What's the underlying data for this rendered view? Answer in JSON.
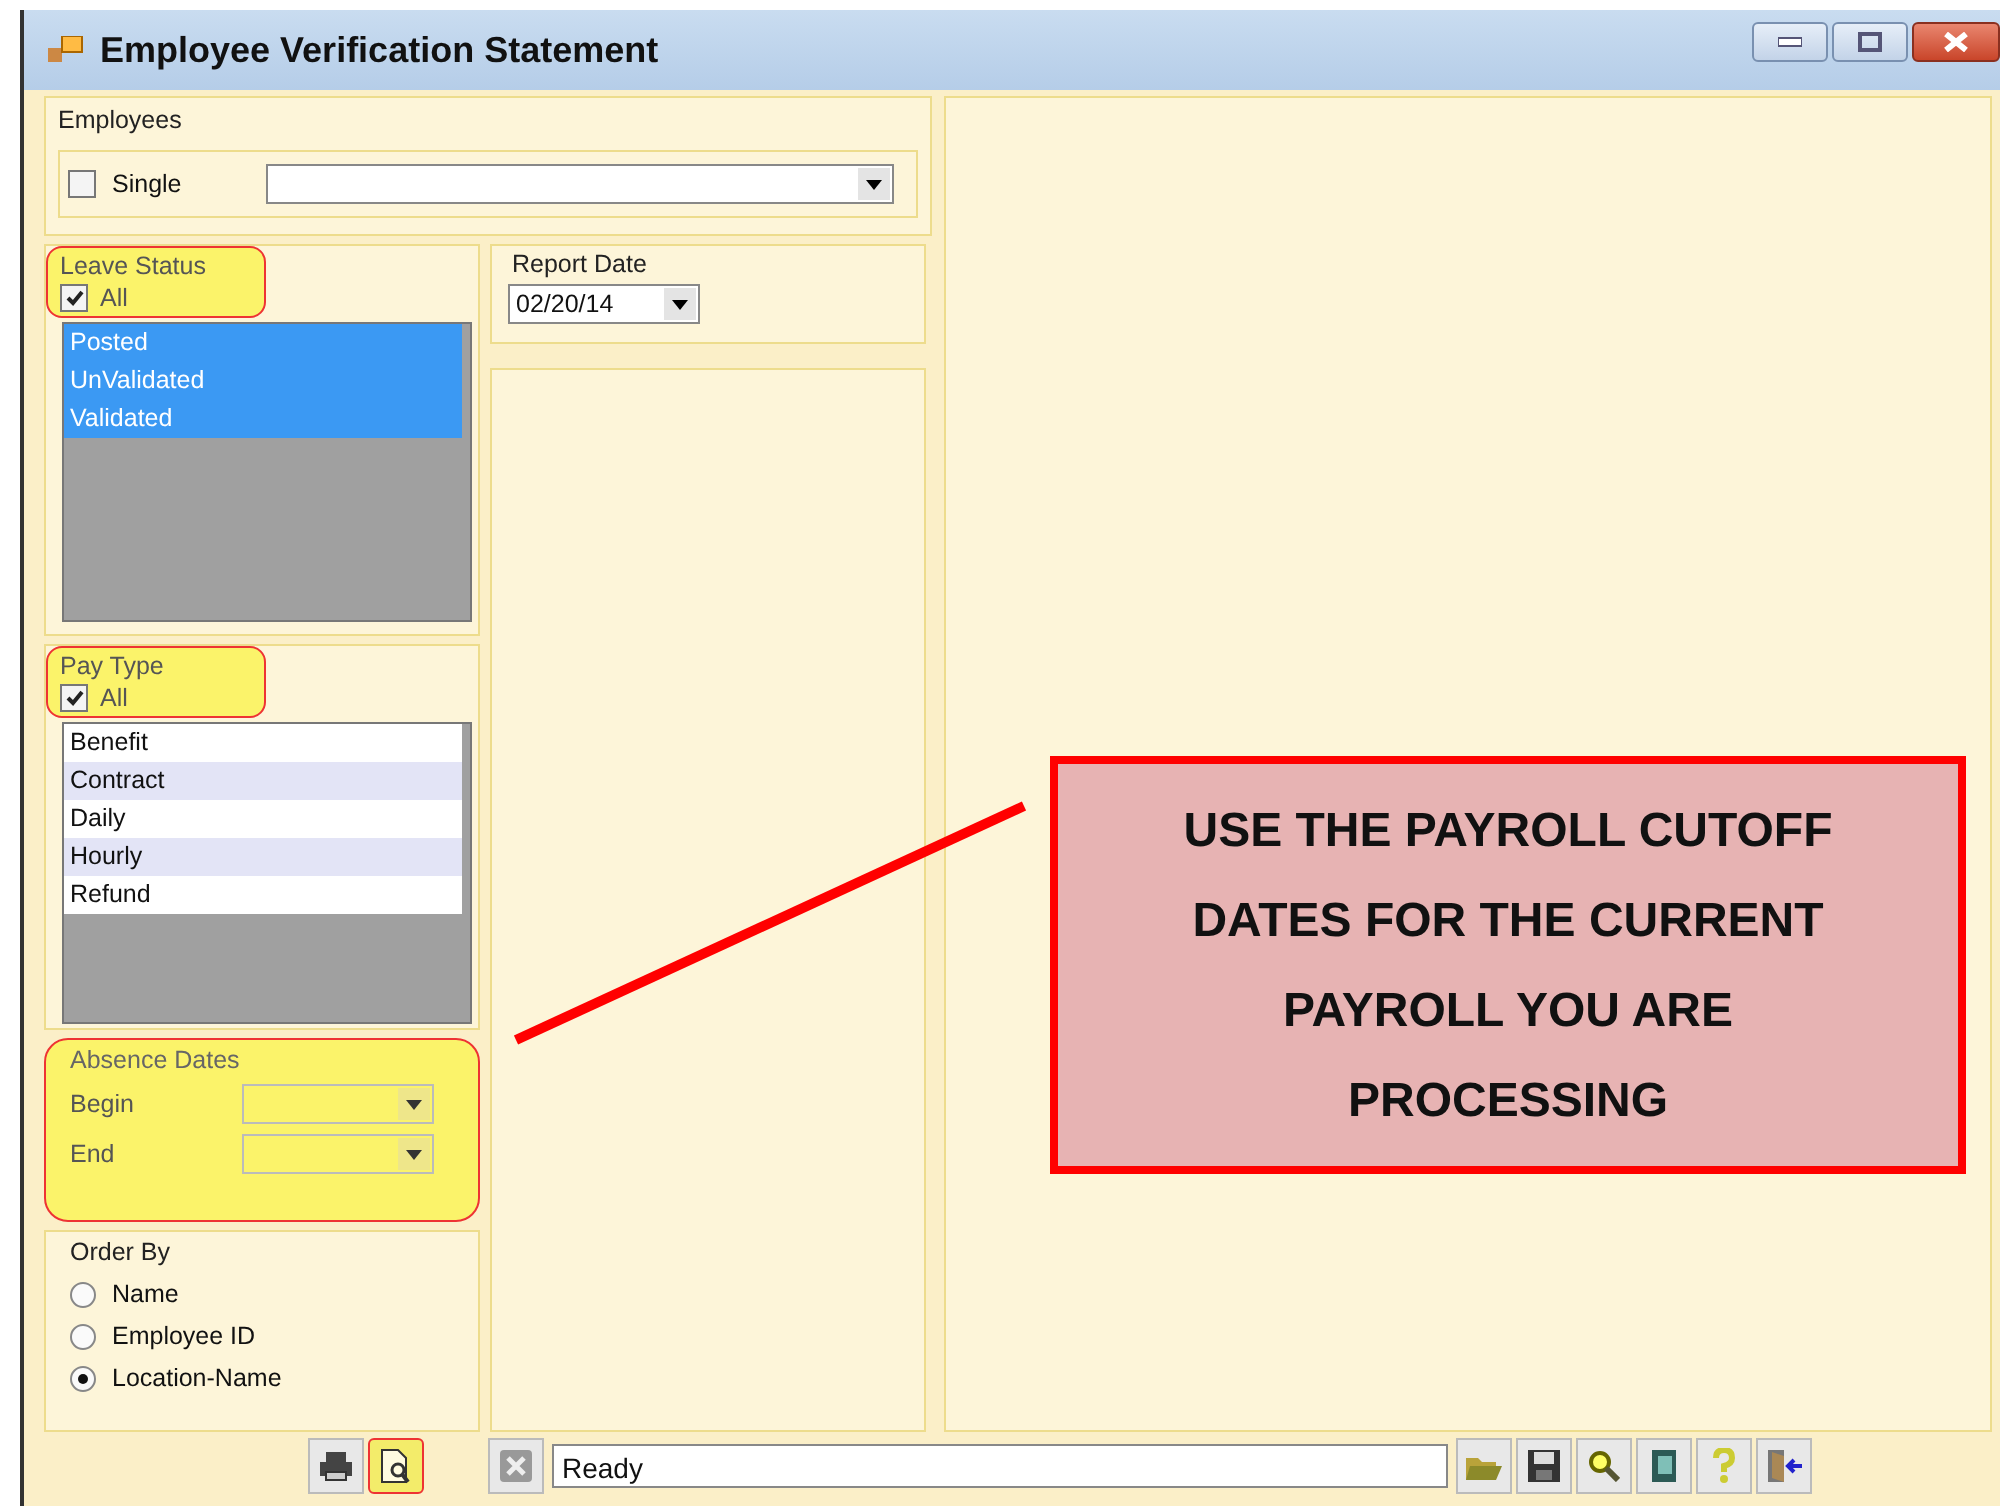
{
  "window": {
    "title": "Employee Verification Statement"
  },
  "employees": {
    "label": "Employees",
    "single": {
      "label": "Single",
      "checked": false
    }
  },
  "leave_status": {
    "label": "Leave Status",
    "highlighted": true,
    "all": {
      "label": "All",
      "checked": true
    },
    "items": [
      {
        "label": "Posted",
        "selected": true
      },
      {
        "label": "UnValidated",
        "selected": true
      },
      {
        "label": "Validated",
        "selected": true
      }
    ]
  },
  "report_date": {
    "label": "Report Date",
    "value": "02/20/14"
  },
  "pay_type": {
    "label": "Pay Type",
    "highlighted": true,
    "all": {
      "label": "All",
      "checked": true
    },
    "items": [
      {
        "label": "Benefit",
        "selected": false
      },
      {
        "label": "Contract",
        "selected": false
      },
      {
        "label": "Daily",
        "selected": false
      },
      {
        "label": "Hourly",
        "selected": false
      },
      {
        "label": "Refund",
        "selected": false
      }
    ]
  },
  "absence_dates": {
    "label": "Absence Dates",
    "highlighted": true,
    "fields": [
      {
        "label": "Begin"
      },
      {
        "label": "End"
      }
    ]
  },
  "order_by": {
    "label": "Order By",
    "options": [
      {
        "label": "Name",
        "selected": false
      },
      {
        "label": "Employee ID",
        "selected": false
      },
      {
        "label": "Location-Name",
        "selected": true
      }
    ]
  },
  "toolbar": {
    "left_buttons": [
      {
        "kind": "print",
        "highlighted": false
      },
      {
        "kind": "preview",
        "highlighted": true
      },
      {
        "kind": "cancel",
        "highlighted": false
      }
    ],
    "status": "Ready",
    "right_buttons": [
      {
        "kind": "open"
      },
      {
        "kind": "save"
      },
      {
        "kind": "search"
      },
      {
        "kind": "book"
      },
      {
        "kind": "help"
      },
      {
        "kind": "exit"
      }
    ]
  },
  "callout": {
    "text": "USE THE PAYROLL CUTOFF DATES FOR THE CURRENT PAYROLL YOU ARE PROCESSING"
  }
}
